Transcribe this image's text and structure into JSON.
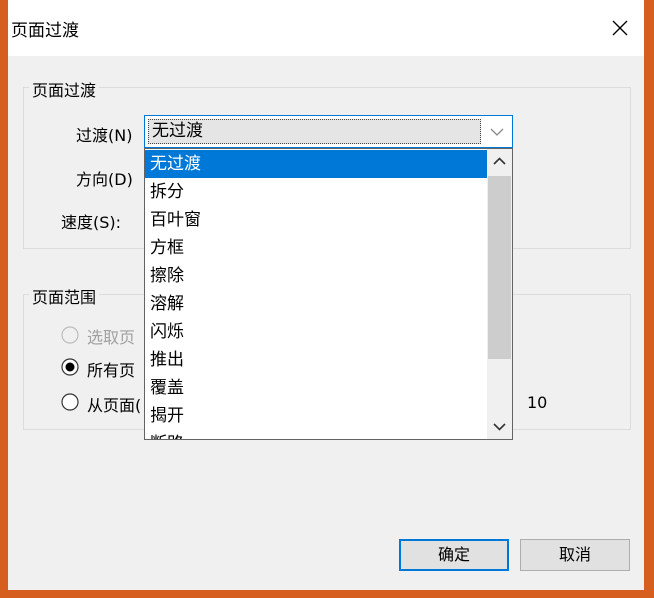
{
  "dialog": {
    "title": "页面过渡",
    "close_icon": "close-icon"
  },
  "transition_group": {
    "legend": "页面过渡",
    "transition_label": "过渡(N)",
    "direction_label": "方向(D)",
    "speed_label": "速度(S):",
    "transition_value": "无过渡",
    "options": [
      "无过渡",
      "拆分",
      "百叶窗",
      "方框",
      "擦除",
      "溶解",
      "闪烁",
      "推出",
      "覆盖",
      "揭开",
      "断路"
    ]
  },
  "range_group": {
    "legend": "页面范围",
    "selected_pages": "选取页",
    "all_pages": "所有页",
    "from_pages": "从页面(",
    "to_value": "10"
  },
  "buttons": {
    "ok": "确定",
    "cancel": "取消"
  },
  "colors": {
    "accent": "#0078d7",
    "background_app": "#d65f1f"
  }
}
